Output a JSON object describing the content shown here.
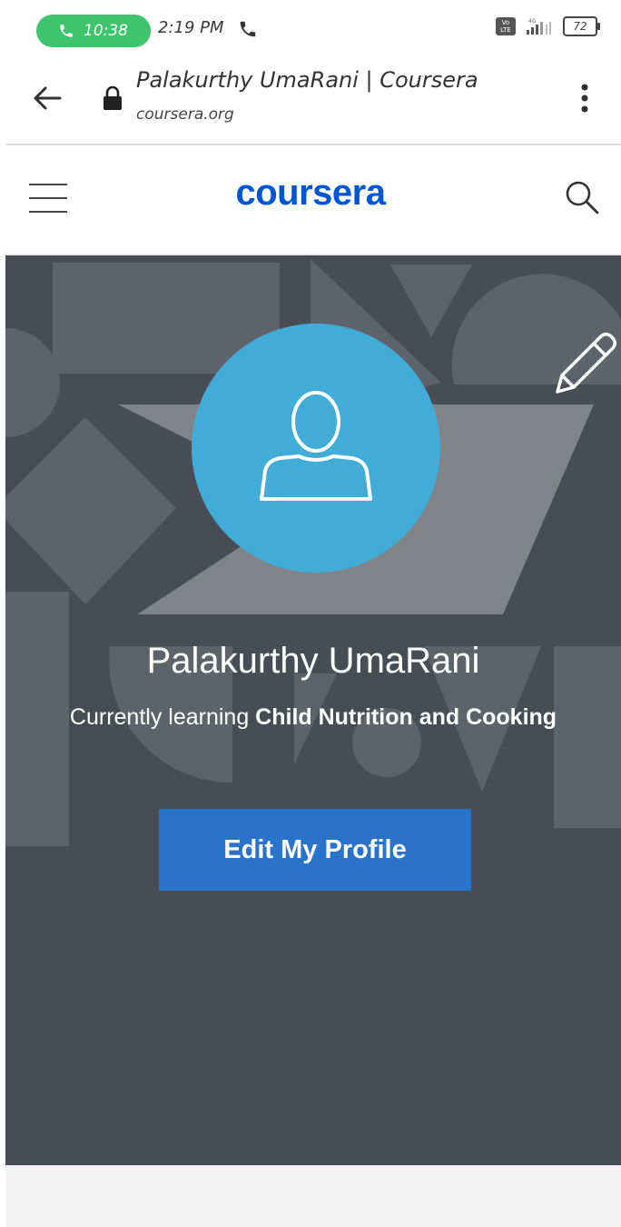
{
  "status_bar": {
    "call_timer": "10:38",
    "time": "2:19 PM",
    "network": "VoLTE 4G",
    "battery": "72"
  },
  "browser": {
    "page_title": "Palakurthy UmaRani | Coursera",
    "domain": "coursera.org"
  },
  "site_header": {
    "logo_text": "coursera"
  },
  "profile": {
    "name": "Palakurthy UmaRani",
    "learning_prefix": "Currently learning ",
    "current_course": "Child Nutrition and Cooking",
    "edit_button_label": "Edit My Profile"
  },
  "colors": {
    "brand": "#0056d2",
    "avatar": "#41acd8",
    "hero_bg": "#474c55",
    "button": "#2a73cc",
    "call_pill": "#3ec46d"
  }
}
